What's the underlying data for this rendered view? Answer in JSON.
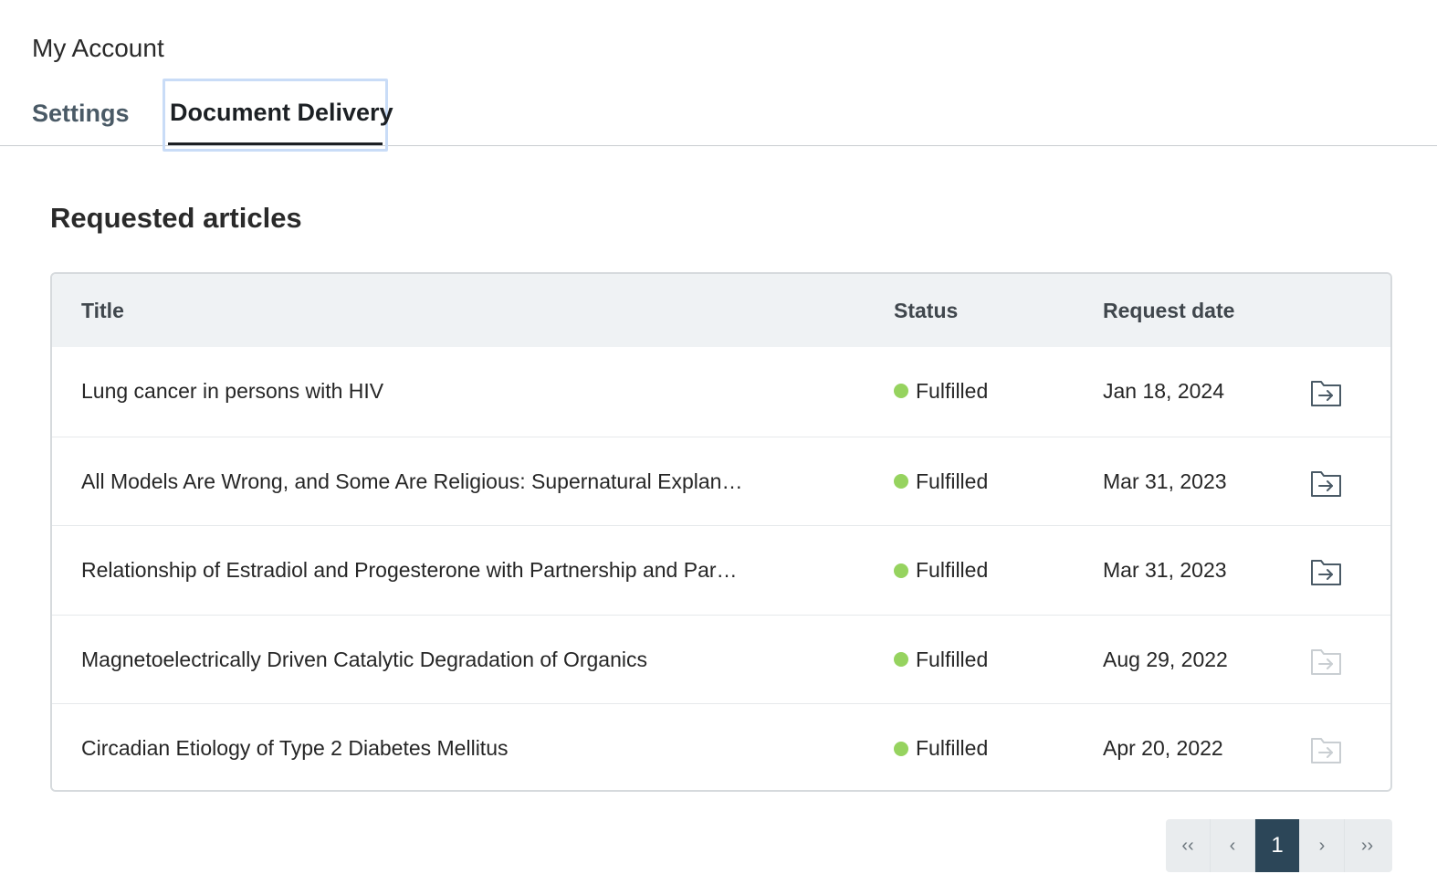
{
  "header": {
    "title": "My Account"
  },
  "tabs": [
    {
      "label": "Settings",
      "active": false
    },
    {
      "label": "Document Delivery",
      "active": true
    }
  ],
  "section": {
    "title": "Requested articles"
  },
  "table": {
    "columns": [
      "Title",
      "Status",
      "Request date"
    ],
    "rows": [
      {
        "title": "Lung cancer in persons with HIV",
        "status": "Fulfilled",
        "date": "Jan 18, 2024",
        "action_enabled": true
      },
      {
        "title": "All Models Are Wrong, and Some Are Religious: Supernatural Explan…",
        "status": "Fulfilled",
        "date": "Mar 31, 2023",
        "action_enabled": true
      },
      {
        "title": "Relationship of Estradiol and Progesterone with Partnership and Par…",
        "status": "Fulfilled",
        "date": "Mar 31, 2023",
        "action_enabled": true
      },
      {
        "title": "Magnetoelectrically Driven Catalytic Degradation of Organics",
        "status": "Fulfilled",
        "date": "Aug 29, 2022",
        "action_enabled": false
      },
      {
        "title": "Circadian Etiology of Type 2 Diabetes Mellitus",
        "status": "Fulfilled",
        "date": "Apr 20, 2022",
        "action_enabled": false
      }
    ],
    "row_action_icon": "open-folder-arrow-icon",
    "status_color": "#96d35f"
  },
  "pagination": {
    "first": "‹‹",
    "prev": "‹",
    "current": "1",
    "next": "›",
    "last": "››"
  },
  "colors": {
    "active_page_bg": "#2c4658",
    "tab_focus_border": "#c9dcf7",
    "header_bg": "#eff2f4"
  }
}
